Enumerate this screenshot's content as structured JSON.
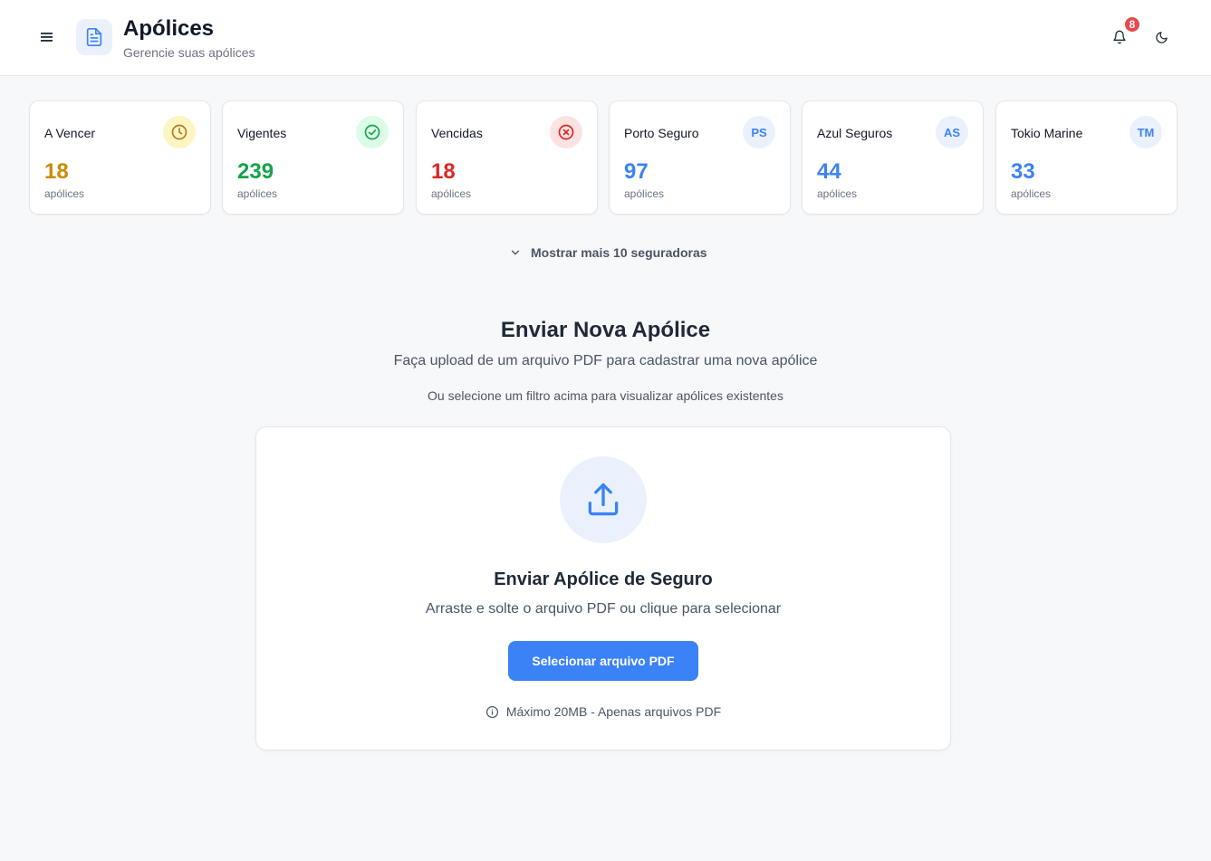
{
  "header": {
    "title": "Apólices",
    "subtitle": "Gerencie suas apólices",
    "notification_count": "8"
  },
  "cards": [
    {
      "label": "A Vencer",
      "value": "18",
      "unit": "apólices",
      "icon": "clock-icon",
      "color": "#ca8a04",
      "icon_bg": "#fdf6c3",
      "icon_color": "#b7791f"
    },
    {
      "label": "Vigentes",
      "value": "239",
      "unit": "apólices",
      "icon": "check-circle-icon",
      "color": "#16a34a",
      "icon_bg": "#dcfce7",
      "icon_color": "#16a34a"
    },
    {
      "label": "Vencidas",
      "value": "18",
      "unit": "apólices",
      "icon": "x-circle-icon",
      "color": "#dc2626",
      "icon_bg": "#fde2e2",
      "icon_color": "#dc2626"
    },
    {
      "label": "Porto Seguro",
      "value": "97",
      "unit": "apólices",
      "initials": "PS",
      "color": "#3b82f6",
      "icon_bg": "#eaf1fd",
      "icon_color": "#3b82f6"
    },
    {
      "label": "Azul Seguros",
      "value": "44",
      "unit": "apólices",
      "initials": "AS",
      "color": "#3b82f6",
      "icon_bg": "#eaf1fd",
      "icon_color": "#3b82f6"
    },
    {
      "label": "Tokio Marine",
      "value": "33",
      "unit": "apólices",
      "initials": "TM",
      "color": "#3b82f6",
      "icon_bg": "#eaf1fd",
      "icon_color": "#3b82f6"
    }
  ],
  "show_more": "Mostrar mais 10 seguradoras",
  "section": {
    "title": "Enviar Nova Apólice",
    "subtitle": "Faça upload de um arquivo PDF para cadastrar uma nova apólice",
    "hint": "Ou selecione um filtro acima para visualizar apólices existentes"
  },
  "upload": {
    "title": "Enviar Apólice de Seguro",
    "description": "Arraste e solte o arquivo PDF ou clique para selecionar",
    "button_label": "Selecionar arquivo PDF",
    "note": "Máximo 20MB - Apenas arquivos PDF"
  },
  "colors": {
    "accent": "#3b82f6",
    "badge": "#e5484d"
  }
}
